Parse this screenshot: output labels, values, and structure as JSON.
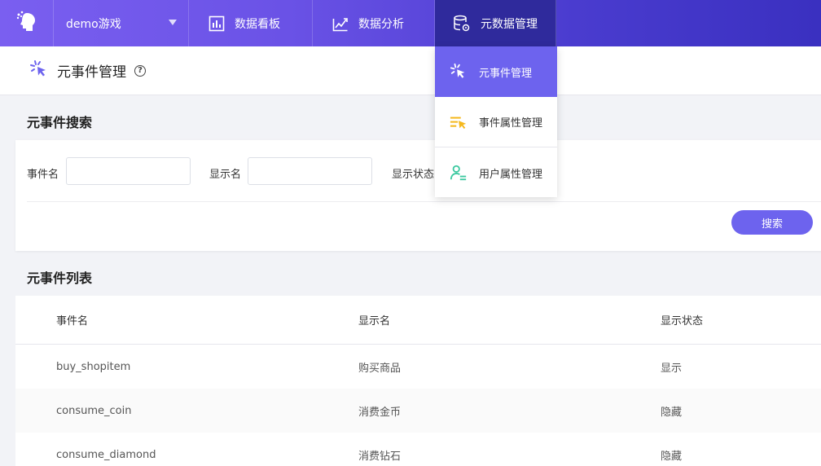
{
  "nav": {
    "project": "demo游戏",
    "items": [
      {
        "label": "数据看板",
        "icon": "bar-chart-icon"
      },
      {
        "label": "数据分析",
        "icon": "trend-chart-icon"
      },
      {
        "label": "元数据管理",
        "icon": "database-gear-icon"
      }
    ]
  },
  "dropdown": {
    "items": [
      {
        "label": "元事件管理",
        "icon": "click-cursor-icon",
        "active": true
      },
      {
        "label": "事件属性管理",
        "icon": "list-cursor-icon"
      },
      {
        "label": "用户属性管理",
        "icon": "user-list-icon"
      }
    ]
  },
  "page": {
    "title": "元事件管理",
    "help": "?"
  },
  "search": {
    "section_title": "元事件搜索",
    "event_name_label": "事件名",
    "display_name_label": "显示名",
    "status_label": "显示状态",
    "event_name_value": "",
    "display_name_value": "",
    "search_button": "搜索"
  },
  "list": {
    "section_title": "元事件列表",
    "columns": [
      "事件名",
      "显示名",
      "显示状态"
    ],
    "rows": [
      [
        "buy_shopitem",
        "购买商品",
        "显示"
      ],
      [
        "consume_coin",
        "消费金币",
        "隐藏"
      ],
      [
        "consume_diamond",
        "消费钻石",
        "隐藏"
      ]
    ]
  },
  "colors": {
    "accent": "#6d63ee",
    "nav_active": "#2f2a9c"
  }
}
